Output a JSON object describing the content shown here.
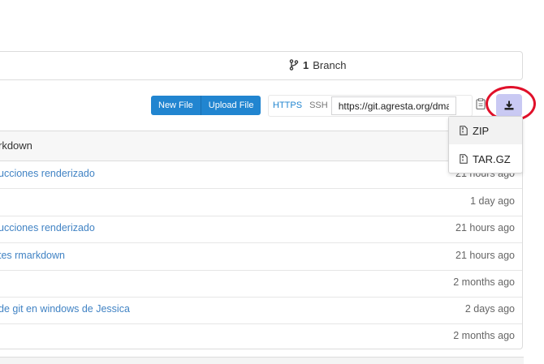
{
  "stats": {
    "branch_count": "1",
    "branch_label": "Branch",
    "branch_icon": "git-branch-icon"
  },
  "toolbar": {
    "new_file": "New File",
    "upload_file": "Upload File",
    "https": "HTTPS",
    "ssh": "SSH",
    "clone_url": "https://git.agresta.org/dma",
    "copy_icon": "clipboard-icon",
    "download_icon": "download-icon"
  },
  "download_menu": {
    "items": [
      {
        "label": "ZIP",
        "icon": "archive-file-icon"
      },
      {
        "label": "TAR.GZ",
        "icon": "archive-file-icon"
      }
    ]
  },
  "file_list": {
    "header": "rkdown",
    "rows": [
      {
        "message": "ucciones renderizado",
        "age": "21 hours ago"
      },
      {
        "message": "",
        "age": "1 day ago"
      },
      {
        "message": "ucciones renderizado",
        "age": "21 hours ago"
      },
      {
        "message": "tes rmarkdown",
        "age": "21 hours ago"
      },
      {
        "message": "",
        "age": "2 months ago"
      },
      {
        "message": "de git en windows de Jessica",
        "age": "2 days ago"
      },
      {
        "message": "",
        "age": "2 months ago"
      }
    ]
  },
  "colors": {
    "primary": "#2185d0",
    "link": "#4183c4",
    "highlight_ring": "#e0102a",
    "download_bg": "#c9c9f3"
  }
}
